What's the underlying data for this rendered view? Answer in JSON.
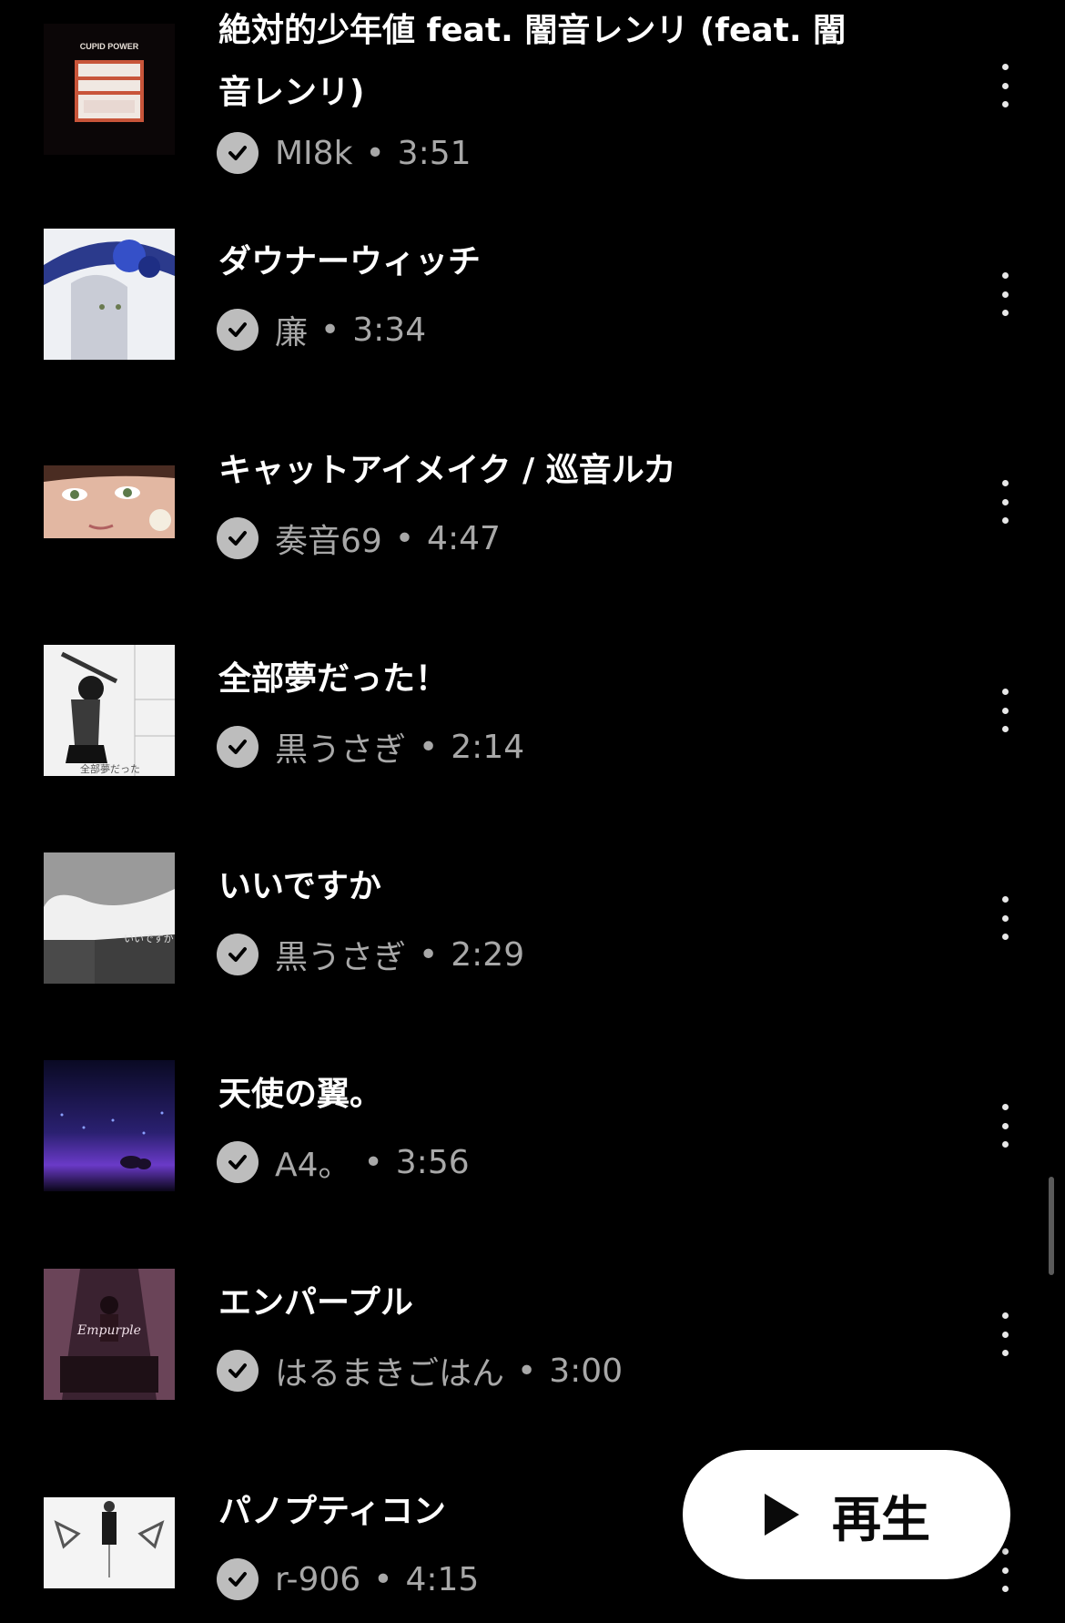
{
  "tracks": [
    {
      "title": "絶対的少年値 feat. 闇音レンリ (feat. 闇音レンリ)",
      "artist": "MI8k",
      "duration": "3:51",
      "thumb_text": "CUPID POWER"
    },
    {
      "title": "ダウナーウィッチ",
      "artist": "廉",
      "duration": "3:34"
    },
    {
      "title": "キャットアイメイク / 巡音ルカ",
      "artist": "奏音69",
      "duration": "4:47"
    },
    {
      "title": "全部夢だった！",
      "artist": "黒うさぎ",
      "duration": "2:14",
      "thumb_text": "全部夢だった"
    },
    {
      "title": "いいですか",
      "artist": "黒うさぎ",
      "duration": "2:29",
      "thumb_text": "いいですか"
    },
    {
      "title": "天使の翼。",
      "artist": "A4。",
      "duration": "3:56"
    },
    {
      "title": "エンパープル",
      "artist": "はるまきごはん",
      "duration": "3:00",
      "thumb_text": "Empurple"
    },
    {
      "title": "パノプティコン",
      "artist": "r-906",
      "duration": "4:15"
    }
  ],
  "separator": "•",
  "play_button": {
    "label": "再生",
    "icon": "play-icon"
  },
  "icons": {
    "downloaded": "check-circle-icon",
    "more": "more-vertical-icon"
  },
  "colors": {
    "background": "#000000",
    "title_text": "#ffffff",
    "meta_text": "#a8a8a8",
    "play_button_bg": "#ffffff"
  }
}
